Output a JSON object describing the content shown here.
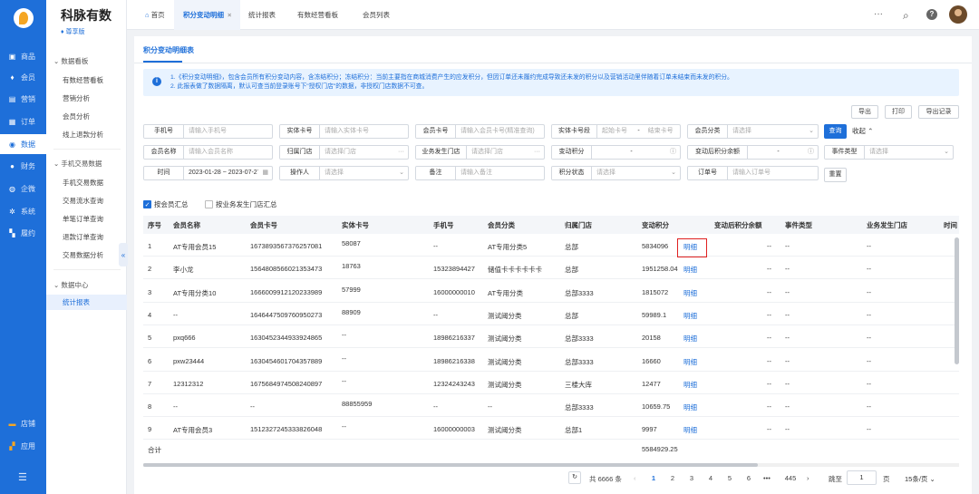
{
  "nav": {
    "items": [
      {
        "label": "商品",
        "icon": "goods-icon"
      },
      {
        "label": "会员",
        "icon": "member-icon"
      },
      {
        "label": "营销",
        "icon": "marketing-icon"
      },
      {
        "label": "订单",
        "icon": "order-icon"
      },
      {
        "label": "数据",
        "icon": "data-icon"
      },
      {
        "label": "财务",
        "icon": "finance-icon"
      },
      {
        "label": "企微",
        "icon": "wecom-icon"
      },
      {
        "label": "系统",
        "icon": "system-icon"
      },
      {
        "label": "履约",
        "icon": "fulfil-icon"
      }
    ],
    "bottom": [
      {
        "label": "店铺",
        "icon": "store-icon"
      },
      {
        "label": "应用",
        "icon": "apps-icon"
      }
    ]
  },
  "sub": {
    "brand": "科脉有数",
    "edition": "尊享版",
    "groups": [
      {
        "title": "数据看板",
        "links": [
          "有数经营看板",
          "营销分析",
          "会员分析",
          "线上退款分析"
        ]
      },
      {
        "title": "手机交易数据",
        "links": [
          "手机交易数据",
          "交易流水查询",
          "单笔订单查询",
          "退款订单查询",
          "交易数据分析"
        ]
      },
      {
        "title": "数据中心",
        "links": [
          "统计报表"
        ]
      }
    ]
  },
  "tabs": [
    {
      "label": "首页"
    },
    {
      "label": "积分变动明细"
    },
    {
      "label": "统计报表"
    },
    {
      "label": "有数经营看板"
    },
    {
      "label": "会员列表"
    }
  ],
  "panel": {
    "title": "积分变动明细表",
    "info1": "1.《积分变动明细》，包含会员所有积分变动内容，含冻结积分；冻结积分：当前主要指在商城消费产生的应发积分，但因订单还未履约完成导致还未发的积分以及营销活动里伴随着订单未结束而未发的积分。",
    "info2": "2. 此报表做了数据隔离，默认可查当前登录账号下\"授权门店\"的数据，非授权门店数据不可查。",
    "btns": {
      "export": "导出",
      "print": "打印",
      "record": "导出记录"
    }
  },
  "filters": {
    "phone": {
      "label": "手机号",
      "ph": "请输入手机号"
    },
    "card": {
      "label": "实体卡号",
      "ph": "请输入实体卡号"
    },
    "member_card": {
      "label": "会员卡号",
      "ph": "请输入会员卡号(精准查询)"
    },
    "card_range": {
      "label": "实体卡号段",
      "ph": "起始卡号",
      "sep": "-",
      "ph2": "结束卡号"
    },
    "member_type": {
      "label": "会员分类",
      "ph": "请选择"
    },
    "name": {
      "label": "会员名称",
      "ph": "请输入会员名称"
    },
    "store": {
      "label": "归属门店",
      "ph": "请选择门店"
    },
    "biz_store": {
      "label": "业务发生门店",
      "ph": "请选择门店"
    },
    "change_pts": {
      "label": "变动积分",
      "dash": "-"
    },
    "after_pts": {
      "label": "变动后积分余额",
      "dash": "-"
    },
    "event_type": {
      "label": "事件类型",
      "ph": "请选择"
    },
    "time": {
      "label": "时间",
      "value": "2023-01-28 ~ 2023-07-27"
    },
    "operator": {
      "label": "操作人",
      "ph": "请选择"
    },
    "remark": {
      "label": "备注",
      "ph": "请输入备注"
    },
    "pts_state": {
      "label": "积分状态",
      "ph": "请选择"
    },
    "order": {
      "label": "订单号",
      "ph": "请输入订单号"
    },
    "query": "查询",
    "fold": "收起",
    "reset": "重置"
  },
  "checks": {
    "by_member": "按会员汇总",
    "by_store": "按业务发生门店汇总"
  },
  "table": {
    "headers": [
      "序号",
      "会员名称",
      "会员卡号",
      "实体卡号",
      "手机号",
      "会员分类",
      "归属门店",
      "变动积分",
      "变动后积分余额",
      "事件类型",
      "业务发生门店",
      "时间"
    ],
    "rows": [
      [
        "1",
        "AT专用会员15",
        "1673893567376257081",
        "58087",
        "--",
        "AT专用分类5",
        "总部",
        "5834096",
        "明细",
        "--",
        "--",
        "--"
      ],
      [
        "2",
        "李小龙",
        "1564808566021353473",
        "18763",
        "15323894427",
        "储值卡卡卡卡卡卡",
        "总部",
        "1951258.04",
        "明细",
        "--",
        "--",
        "--"
      ],
      [
        "3",
        "AT专用分类10",
        "1666009912120233989",
        "57999",
        "16000000010",
        "AT专用分类",
        "总部3333",
        "1815072",
        "明细",
        "--",
        "--",
        "--"
      ],
      [
        "4",
        "--",
        "1646447509760950273",
        "88909",
        "--",
        "测试阈分类",
        "总部",
        "59989.1",
        "明细",
        "--",
        "--",
        "--"
      ],
      [
        "5",
        "pxq666",
        "1630452344933924865",
        "--",
        "18986216337",
        "测试阈分类",
        "总部3333",
        "20158",
        "明细",
        "--",
        "--",
        "--"
      ],
      [
        "6",
        "pxw23444",
        "1630454601704357889",
        "--",
        "18986216338",
        "测试阈分类",
        "总部3333",
        "16660",
        "明细",
        "--",
        "--",
        "--"
      ],
      [
        "7",
        "12312312",
        "1675684974508240897",
        "--",
        "12324243243",
        "测试阈分类",
        "三楼大库",
        "12477",
        "明细",
        "--",
        "--",
        "--"
      ],
      [
        "8",
        "--",
        "--",
        "88855959",
        "--",
        "--",
        "总部3333",
        "10659.75",
        "明细",
        "--",
        "--",
        "--"
      ],
      [
        "9",
        "AT专用会员3",
        "1512327245333826048",
        "--",
        "16000000003",
        "测试阈分类",
        "总部1",
        "9997",
        "明细",
        "--",
        "--",
        "--"
      ]
    ],
    "sum_label": "合计",
    "sum_value": "5584929.25"
  },
  "pager": {
    "total": "共 6666 条",
    "pages": [
      "1",
      "2",
      "3",
      "4",
      "5",
      "6",
      "•••",
      "445"
    ],
    "goto": "跳至",
    "page_val": "1",
    "page_unit": "页",
    "size": "15条/页"
  }
}
